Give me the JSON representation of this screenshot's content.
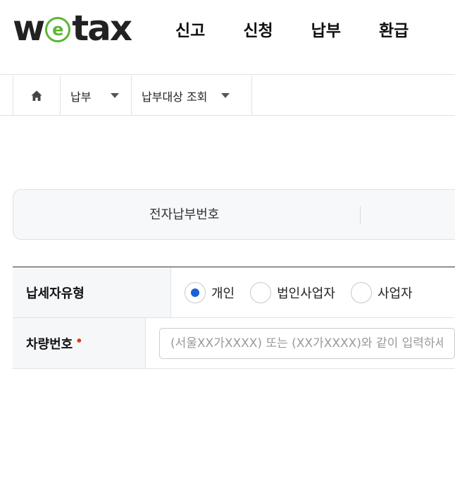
{
  "logo": {
    "prefix": "w",
    "e": "e",
    "suffix": "tax"
  },
  "gnb": {
    "items": [
      "신고",
      "신청",
      "납부",
      "환급"
    ]
  },
  "breadcrumb": {
    "level1": "납부",
    "level2": "납부대상 조회"
  },
  "tabs": {
    "tab1": "전자납부번호"
  },
  "form": {
    "taxpayer_type_label": "납세자유형",
    "options": [
      "개인",
      "법인사업자",
      "사업자"
    ],
    "selected_option": "개인",
    "vehicle_label": "차량번호",
    "required_mark": "•",
    "vehicle_placeholder": "(서울XX가XXXX) 또는 (XX가XXXX)와 같이 입력하세요"
  },
  "colors": {
    "brand_green": "#5cb531",
    "radio_selected": "#1a5fd6",
    "required": "#e8380d"
  }
}
